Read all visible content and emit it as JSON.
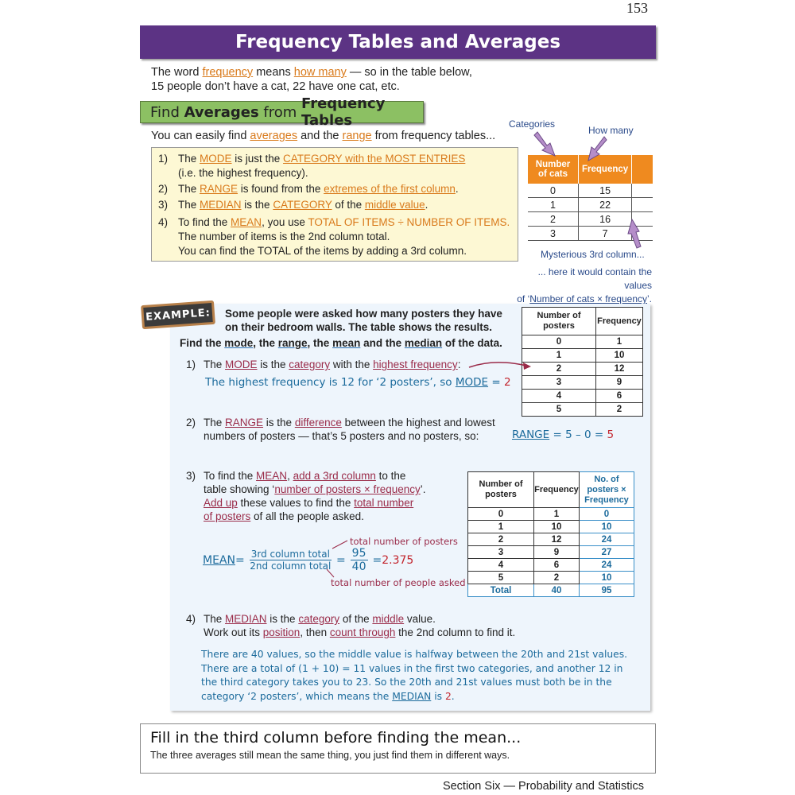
{
  "page_number": "153",
  "title": "Frequency Tables and Averages",
  "intro": {
    "t1": "The word ",
    "frequency": "frequency",
    "t2": " means ",
    "how_many": "how many",
    "t3": " — so in the table below,",
    "line2": "15 people don’t have a cat, 22 have one cat, etc."
  },
  "section_heading": {
    "w1": "Find ",
    "w2": "Averages",
    "w3": " from ",
    "w4": "Frequency Tables"
  },
  "easily": {
    "t1": "You can easily find ",
    "averages": "averages",
    "t2": " and the ",
    "range": "range",
    "t3": " from frequency tables..."
  },
  "rules": [
    {
      "num": "1)",
      "a": "The ",
      "b": "MODE",
      "c": " is just the ",
      "d": "CATEGORY with the MOST ENTRIES",
      "e": "",
      "line2": "(i.e. the highest frequency)."
    },
    {
      "num": "2)",
      "a": "The ",
      "b": "RANGE",
      "c": " is found from the ",
      "d": "extremes of the first column",
      "e": "."
    },
    {
      "num": "3)",
      "a": "The ",
      "b": "MEDIAN",
      "c": " is the ",
      "d": "CATEGORY",
      "e": " of the ",
      "f": "middle value",
      "g": "."
    },
    {
      "num": "4)",
      "a": "To find the ",
      "b": "MEAN",
      "c": ", you use ",
      "d": "TOTAL OF ITEMS ÷ NUMBER OF ITEMS.",
      "line2": "The number of items is the 2nd column total.",
      "line3": "You can find the TOTAL of the items by adding a 3rd column."
    }
  ],
  "cats_diagram": {
    "categories_label": "Categories",
    "how_many_label": "How many",
    "headers": [
      "Number of cats",
      "Frequency",
      ""
    ],
    "rows": [
      [
        "0",
        "15"
      ],
      [
        "1",
        "22"
      ],
      [
        "2",
        "16"
      ],
      [
        "3",
        "7"
      ]
    ],
    "mysterious": "Mysterious 3rd column...",
    "here1": "... here it would contain the values",
    "here2a": "of ‘",
    "here2b": "Number of cats × frequency",
    "here2c": "’."
  },
  "example": {
    "badge": "EXAMPLE:",
    "question": "Some people were asked how many posters they have on their bedroom walls.  The table shows the results.",
    "find": {
      "a": "Find the ",
      "mode": "mode",
      "b": ", the ",
      "range": "range",
      "c": ", the ",
      "mean": "mean",
      "d": " and the ",
      "median": "median",
      "e": " of the data."
    },
    "table1": {
      "headers": [
        "Number of posters",
        "Frequency"
      ],
      "rows": [
        [
          "0",
          "1"
        ],
        [
          "1",
          "10"
        ],
        [
          "2",
          "12"
        ],
        [
          "3",
          "9"
        ],
        [
          "4",
          "6"
        ],
        [
          "5",
          "2"
        ]
      ]
    },
    "step1": {
      "num": "1)",
      "a": "The ",
      "mode": "MODE",
      "b": " is the ",
      "category": "category",
      "c": " with the ",
      "hf": "highest frequency",
      "d": ":",
      "answer_a": "The highest frequency is 12 for ‘2 posters’, so ",
      "answer_mode": "MODE",
      "answer_eq": " = ",
      "answer_val": "2"
    },
    "step2": {
      "num": "2)",
      "a": "The ",
      "range": "RANGE",
      "b": " is the ",
      "difference": "difference",
      "c": " between the highest and lowest",
      "line2": "numbers of posters — that’s 5 posters and no posters, so:",
      "ans_range": "RANGE",
      "ans_expr": " = 5 – 0 = ",
      "ans_val": "5"
    },
    "step3": {
      "num": "3)",
      "a": "To find the ",
      "mean": "MEAN",
      "b": ", ",
      "add3": "add a 3rd column",
      "c": " to the",
      "d": "table showing ‘",
      "npf": "number of posters × frequency",
      "e": "’.",
      "addup": "Add up",
      "f": " these values to find the ",
      "tn1": "total number",
      "tn2": "of posters",
      "g": " of all the people asked.",
      "mean_label": "MEAN",
      "eq": " = ",
      "frac1_top": "3rd column total",
      "frac1_bot": "2nd column total",
      "frac2_top": "95",
      "frac2_bot": "40",
      "result_eq": " = ",
      "result": "2.375",
      "annot_top": "total number of posters",
      "annot_bot": "total number of people asked"
    },
    "table2": {
      "headers": [
        "Number of posters",
        "Frequency",
        "No. of posters × Frequency"
      ],
      "rows": [
        [
          "0",
          "1",
          "0"
        ],
        [
          "1",
          "10",
          "10"
        ],
        [
          "2",
          "12",
          "24"
        ],
        [
          "3",
          "9",
          "27"
        ],
        [
          "4",
          "6",
          "24"
        ],
        [
          "5",
          "2",
          "10"
        ]
      ],
      "total": [
        "Total",
        "40",
        "95"
      ]
    },
    "step4": {
      "num": "4)",
      "a": "The ",
      "median": "MEDIAN",
      "b": " is the ",
      "category": "category",
      "c": " of the ",
      "middle": "middle",
      "d": " value.",
      "e": "Work out its ",
      "position": "position",
      "f": ", then ",
      "ct": "count through",
      "g": " the 2nd column to find it.",
      "expl1": "There are 40 values, so the middle value is halfway between the 20th and 21st values.",
      "expl2": "There are a total of (1 + 10) = 11 values in the first two categories, and another 12 in",
      "expl3": "the third category takes you to 23.  So the 20th and 21st values must both be in the",
      "expl4a": "category ‘2 posters’, which means the ",
      "expl4_median": "MEDIAN",
      "expl4b": " is ",
      "expl4_val": "2",
      "expl4c": "."
    }
  },
  "tip": {
    "title": "Fill in the third column before finding the mean...",
    "body": "The three averages still mean the same thing, you just find them in different ways."
  },
  "footer": "Section Six — Probability and Statistics",
  "colors": {
    "title_bar": "#5c3384",
    "heading_green": "#8cc063",
    "highlight_orange": "#d97a1b",
    "example_panel": "#eef5fc",
    "answer_blue": "#1c6b9c",
    "emph_red": "#9a2b49",
    "table_orange": "#ef8a1f"
  }
}
